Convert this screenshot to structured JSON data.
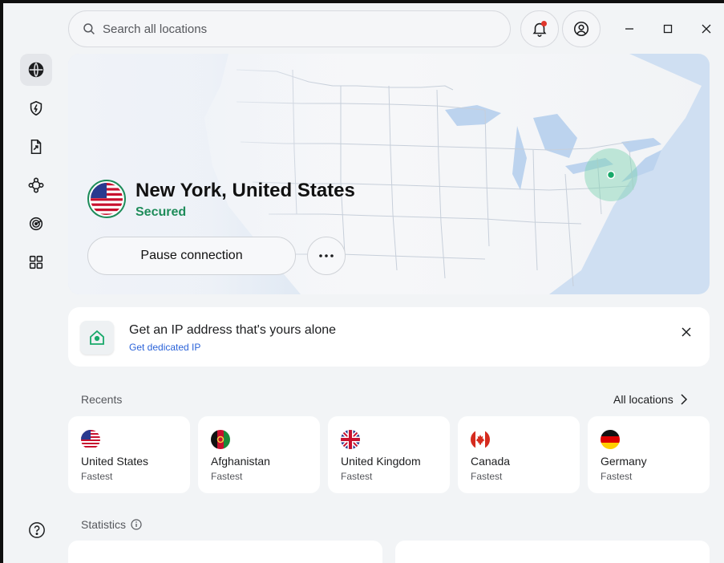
{
  "search": {
    "placeholder": "Search all locations"
  },
  "sidebar": {
    "items": [
      {
        "name": "globe-icon",
        "active": true
      },
      {
        "name": "shield-bolt-icon"
      },
      {
        "name": "file-share-icon"
      },
      {
        "name": "meshnet-icon"
      },
      {
        "name": "radar-icon"
      },
      {
        "name": "apps-grid-icon"
      }
    ]
  },
  "connection": {
    "location": "New York, United States",
    "status": "Secured",
    "pause_label": "Pause connection"
  },
  "promo": {
    "title": "Get an IP address that's yours alone",
    "link": "Get dedicated IP"
  },
  "recents": {
    "title": "Recents",
    "all_locations": "All locations",
    "items": [
      {
        "name": "United States",
        "sub": "Fastest"
      },
      {
        "name": "Afghanistan",
        "sub": "Fastest"
      },
      {
        "name": "United Kingdom",
        "sub": "Fastest"
      },
      {
        "name": "Canada",
        "sub": "Fastest"
      },
      {
        "name": "Germany",
        "sub": "Fastest"
      }
    ]
  },
  "statistics": {
    "title": "Statistics"
  },
  "colors": {
    "accent_green": "#1e8c5a",
    "link_blue": "#2b63d9",
    "notification_red": "#e0362c"
  }
}
